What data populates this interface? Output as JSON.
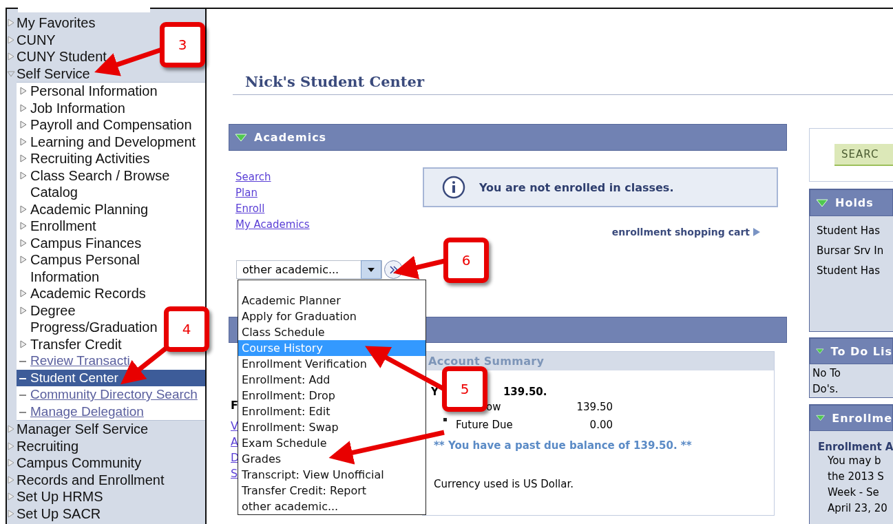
{
  "sidebar": {
    "items": [
      {
        "label": "My Favorites",
        "expanded": false
      },
      {
        "label": "CUNY",
        "expanded": false
      },
      {
        "label": "CUNY Student",
        "expanded": false
      },
      {
        "label": "Self Service",
        "expanded": true,
        "children": [
          {
            "label": "Personal Information",
            "kind": "folder"
          },
          {
            "label": "Job Information",
            "kind": "folder"
          },
          {
            "label": "Payroll and Compensation",
            "kind": "folder"
          },
          {
            "label": "Learning and Development",
            "kind": "folder"
          },
          {
            "label": "Recruiting Activities",
            "kind": "folder"
          },
          {
            "label": "Class Search / Browse Catalog",
            "kind": "folder"
          },
          {
            "label": "Academic Planning",
            "kind": "folder"
          },
          {
            "label": "Enrollment",
            "kind": "folder"
          },
          {
            "label": "Campus Finances",
            "kind": "folder"
          },
          {
            "label": "Campus Personal Information",
            "kind": "folder"
          },
          {
            "label": "Academic Records",
            "kind": "folder"
          },
          {
            "label": "Degree Progress/Graduation",
            "kind": "folder"
          },
          {
            "label": "Transfer Credit",
            "kind": "folder"
          },
          {
            "label": "Review Transacti",
            "kind": "link",
            "selected": false
          },
          {
            "label": "Student Center",
            "kind": "link",
            "selected": true
          },
          {
            "label": "Community Directory Search",
            "kind": "link",
            "selected": false
          },
          {
            "label": "Manage Delegation",
            "kind": "link",
            "selected": false
          }
        ]
      },
      {
        "label": "Manager Self Service",
        "expanded": false
      },
      {
        "label": "Recruiting",
        "expanded": false
      },
      {
        "label": "Campus Community",
        "expanded": false
      },
      {
        "label": "Records and Enrollment",
        "expanded": false
      },
      {
        "label": "Set Up HRMS",
        "expanded": false
      },
      {
        "label": "Set Up SACR",
        "expanded": false
      }
    ]
  },
  "page_title": "Nick's Student Center",
  "academics": {
    "title": "Academics",
    "links": [
      "Search",
      "Plan",
      "Enroll",
      "My Academics"
    ],
    "notice": "You are not enrolled in classes.",
    "cart_link": "enrollment shopping cart",
    "select": {
      "value": "other academic..."
    },
    "dropdown": [
      {
        "label": "Academic Planner",
        "selected": false
      },
      {
        "label": "Apply for Graduation",
        "selected": false
      },
      {
        "label": "Class Schedule",
        "selected": false
      },
      {
        "label": "Course History",
        "selected": true
      },
      {
        "label": "Enrollment Verification",
        "selected": false
      },
      {
        "label": "Enrollment: Add",
        "selected": false
      },
      {
        "label": "Enrollment: Drop",
        "selected": false
      },
      {
        "label": "Enrollment: Edit",
        "selected": false
      },
      {
        "label": "Enrollment: Swap",
        "selected": false
      },
      {
        "label": "Exam Schedule",
        "selected": false
      },
      {
        "label": "Grades",
        "selected": false
      },
      {
        "label": "Transcript: View Unofficial",
        "selected": false
      },
      {
        "label": "Transfer Credit: Report",
        "selected": false
      },
      {
        "label": "other academic...",
        "selected": false
      }
    ]
  },
  "finances": {
    "fragments": [
      {
        "text": "F",
        "kind": "heading"
      },
      {
        "text": "V",
        "kind": "link"
      },
      {
        "text": "A",
        "kind": "link"
      },
      {
        "text": "D",
        "kind": "link"
      },
      {
        "text": "S",
        "kind": "link"
      }
    ],
    "account_summary": {
      "title": "Account Summary",
      "owe": {
        "start": "Y",
        "end": "139.50."
      },
      "rows": [
        {
          "label": "ow",
          "amount": "139.50"
        },
        {
          "label": "Future Due",
          "amount": "0.00"
        }
      ],
      "warning": "** You have a past due balance of 139.50. **",
      "currency": "Currency used is US Dollar."
    }
  },
  "right": {
    "search_button": "SEARC",
    "holds": {
      "title": "Holds",
      "items": [
        "Student Has",
        "Bursar Srv In",
        "Student Has"
      ]
    },
    "todo": {
      "title": "To Do Lis",
      "text": "No To Do's."
    },
    "enrollment": {
      "title": "Enrollme",
      "subtitle": "Enrollment A",
      "lines": [
        "You may b",
        "the 2013 S",
        "Week - Se",
        "April 23, 20"
      ]
    }
  },
  "callouts": [
    "3",
    "4",
    "6",
    "5"
  ]
}
